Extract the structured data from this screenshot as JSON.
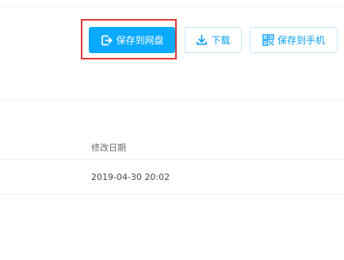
{
  "toolbar": {
    "save_to_netdisk": {
      "label": "保存到网盘",
      "icon": "save-export-icon"
    },
    "download": {
      "label": "下载",
      "icon": "download-icon"
    },
    "save_to_phone": {
      "label": "保存到手机",
      "icon": "qr-phone-icon"
    }
  },
  "file_table": {
    "columns": [
      {
        "label": "修改日期"
      }
    ],
    "rows": [
      {
        "modified": "2019-04-30 20:02"
      }
    ]
  },
  "colors": {
    "primary": "#09aaff",
    "highlight": "#e53935",
    "secondary_border": "#c8e6fb",
    "secondary_text": "#0a9ff5"
  }
}
